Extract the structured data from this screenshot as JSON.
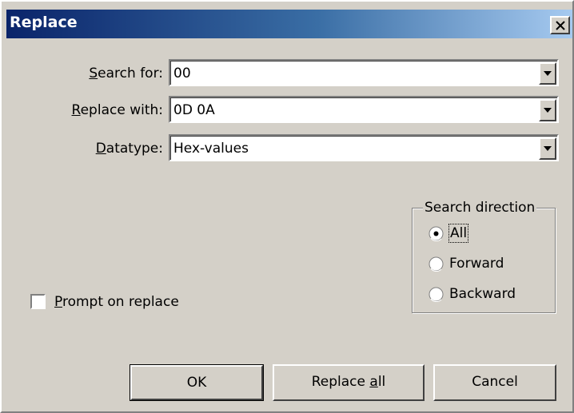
{
  "window": {
    "title": "Replace",
    "close_glyph": "✕"
  },
  "fields": {
    "search_for": {
      "label_prefix": "",
      "label_accel": "S",
      "label_rest": "earch for:",
      "value": "00"
    },
    "replace_with": {
      "label_prefix": "",
      "label_accel": "R",
      "label_rest": "eplace with:",
      "value": "0D 0A"
    },
    "datatype": {
      "label_prefix": "",
      "label_accel": "D",
      "label_rest": "atatype:",
      "value": "Hex-values"
    }
  },
  "options": {
    "prompt_on_replace": {
      "label_accel": "P",
      "label_rest": "rompt on replace",
      "checked": false
    }
  },
  "search_direction": {
    "legend": "Search direction",
    "options": [
      {
        "label": "All",
        "selected": true
      },
      {
        "label": "Forward",
        "selected": false
      },
      {
        "label": "Backward",
        "selected": false
      }
    ]
  },
  "buttons": {
    "ok": "OK",
    "replace_all_prefix": "Replace ",
    "replace_all_accel": "a",
    "replace_all_rest": "ll",
    "cancel": "Cancel"
  },
  "icons": {
    "close": "close-icon",
    "dropdown": "chevron-down-icon",
    "radio": "radio-icon"
  }
}
